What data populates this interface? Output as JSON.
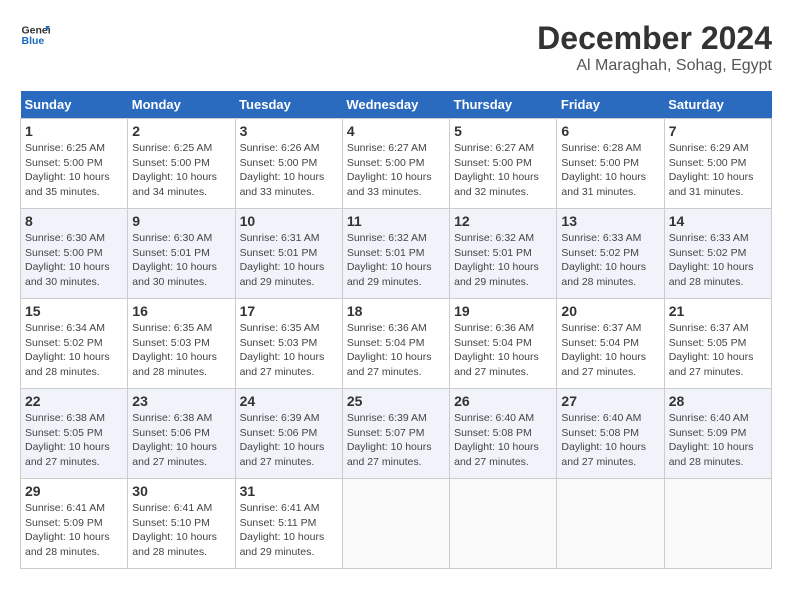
{
  "logo": {
    "text_general": "General",
    "text_blue": "Blue"
  },
  "title": "December 2024",
  "subtitle": "Al Maraghah, Sohag, Egypt",
  "headers": [
    "Sunday",
    "Monday",
    "Tuesday",
    "Wednesday",
    "Thursday",
    "Friday",
    "Saturday"
  ],
  "weeks": [
    [
      {
        "day": "1",
        "sunrise": "6:25 AM",
        "sunset": "5:00 PM",
        "daylight": "10 hours and 35 minutes."
      },
      {
        "day": "2",
        "sunrise": "6:25 AM",
        "sunset": "5:00 PM",
        "daylight": "10 hours and 34 minutes."
      },
      {
        "day": "3",
        "sunrise": "6:26 AM",
        "sunset": "5:00 PM",
        "daylight": "10 hours and 33 minutes."
      },
      {
        "day": "4",
        "sunrise": "6:27 AM",
        "sunset": "5:00 PM",
        "daylight": "10 hours and 33 minutes."
      },
      {
        "day": "5",
        "sunrise": "6:27 AM",
        "sunset": "5:00 PM",
        "daylight": "10 hours and 32 minutes."
      },
      {
        "day": "6",
        "sunrise": "6:28 AM",
        "sunset": "5:00 PM",
        "daylight": "10 hours and 31 minutes."
      },
      {
        "day": "7",
        "sunrise": "6:29 AM",
        "sunset": "5:00 PM",
        "daylight": "10 hours and 31 minutes."
      }
    ],
    [
      {
        "day": "8",
        "sunrise": "6:30 AM",
        "sunset": "5:00 PM",
        "daylight": "10 hours and 30 minutes."
      },
      {
        "day": "9",
        "sunrise": "6:30 AM",
        "sunset": "5:01 PM",
        "daylight": "10 hours and 30 minutes."
      },
      {
        "day": "10",
        "sunrise": "6:31 AM",
        "sunset": "5:01 PM",
        "daylight": "10 hours and 29 minutes."
      },
      {
        "day": "11",
        "sunrise": "6:32 AM",
        "sunset": "5:01 PM",
        "daylight": "10 hours and 29 minutes."
      },
      {
        "day": "12",
        "sunrise": "6:32 AM",
        "sunset": "5:01 PM",
        "daylight": "10 hours and 29 minutes."
      },
      {
        "day": "13",
        "sunrise": "6:33 AM",
        "sunset": "5:02 PM",
        "daylight": "10 hours and 28 minutes."
      },
      {
        "day": "14",
        "sunrise": "6:33 AM",
        "sunset": "5:02 PM",
        "daylight": "10 hours and 28 minutes."
      }
    ],
    [
      {
        "day": "15",
        "sunrise": "6:34 AM",
        "sunset": "5:02 PM",
        "daylight": "10 hours and 28 minutes."
      },
      {
        "day": "16",
        "sunrise": "6:35 AM",
        "sunset": "5:03 PM",
        "daylight": "10 hours and 28 minutes."
      },
      {
        "day": "17",
        "sunrise": "6:35 AM",
        "sunset": "5:03 PM",
        "daylight": "10 hours and 27 minutes."
      },
      {
        "day": "18",
        "sunrise": "6:36 AM",
        "sunset": "5:04 PM",
        "daylight": "10 hours and 27 minutes."
      },
      {
        "day": "19",
        "sunrise": "6:36 AM",
        "sunset": "5:04 PM",
        "daylight": "10 hours and 27 minutes."
      },
      {
        "day": "20",
        "sunrise": "6:37 AM",
        "sunset": "5:04 PM",
        "daylight": "10 hours and 27 minutes."
      },
      {
        "day": "21",
        "sunrise": "6:37 AM",
        "sunset": "5:05 PM",
        "daylight": "10 hours and 27 minutes."
      }
    ],
    [
      {
        "day": "22",
        "sunrise": "6:38 AM",
        "sunset": "5:05 PM",
        "daylight": "10 hours and 27 minutes."
      },
      {
        "day": "23",
        "sunrise": "6:38 AM",
        "sunset": "5:06 PM",
        "daylight": "10 hours and 27 minutes."
      },
      {
        "day": "24",
        "sunrise": "6:39 AM",
        "sunset": "5:06 PM",
        "daylight": "10 hours and 27 minutes."
      },
      {
        "day": "25",
        "sunrise": "6:39 AM",
        "sunset": "5:07 PM",
        "daylight": "10 hours and 27 minutes."
      },
      {
        "day": "26",
        "sunrise": "6:40 AM",
        "sunset": "5:08 PM",
        "daylight": "10 hours and 27 minutes."
      },
      {
        "day": "27",
        "sunrise": "6:40 AM",
        "sunset": "5:08 PM",
        "daylight": "10 hours and 27 minutes."
      },
      {
        "day": "28",
        "sunrise": "6:40 AM",
        "sunset": "5:09 PM",
        "daylight": "10 hours and 28 minutes."
      }
    ],
    [
      {
        "day": "29",
        "sunrise": "6:41 AM",
        "sunset": "5:09 PM",
        "daylight": "10 hours and 28 minutes."
      },
      {
        "day": "30",
        "sunrise": "6:41 AM",
        "sunset": "5:10 PM",
        "daylight": "10 hours and 28 minutes."
      },
      {
        "day": "31",
        "sunrise": "6:41 AM",
        "sunset": "5:11 PM",
        "daylight": "10 hours and 29 minutes."
      },
      null,
      null,
      null,
      null
    ]
  ]
}
